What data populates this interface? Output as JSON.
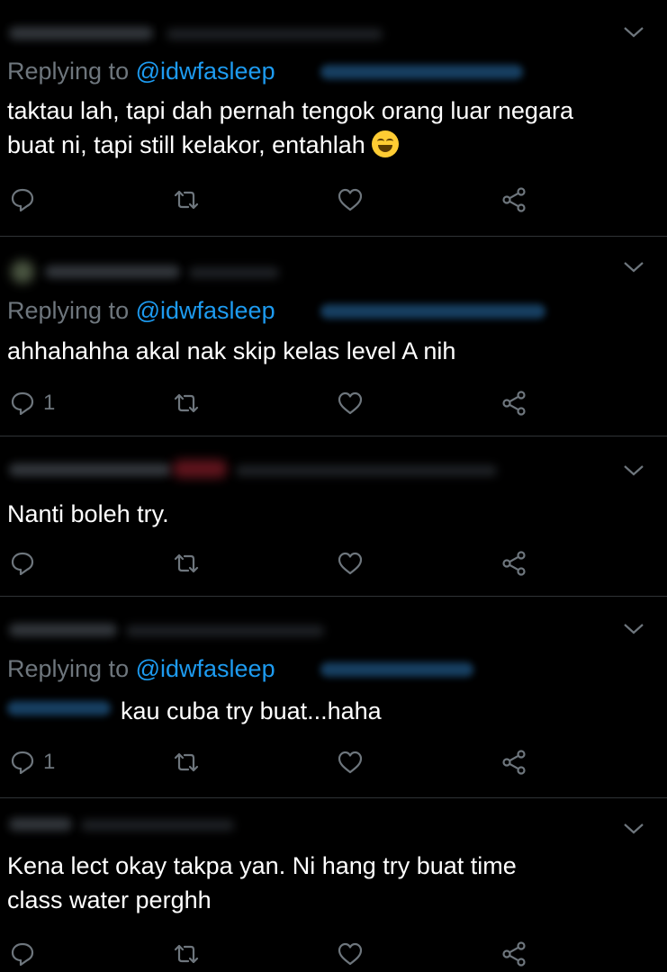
{
  "colors": {
    "background": "#000000",
    "text": "#ffffff",
    "muted": "#6e767d",
    "mention": "#1d9bf0",
    "divider": "#2f3336"
  },
  "tweets": [
    {
      "replying_prefix": "Replying to ",
      "replying_mention": "@idwfasleep",
      "text_line1": "taktau lah, tapi dah pernah tengok orang luar negara",
      "text_line2": "buat ni, tapi still kelakor, entahlah",
      "emoji": "face-with-tears-of-joy",
      "reply_count": ""
    },
    {
      "replying_prefix": "Replying to ",
      "replying_mention": "@idwfasleep",
      "text_line1": "ahhahahha  akal nak skip kelas level A nih",
      "reply_count": "1"
    },
    {
      "text_line1": "Nanti boleh try.",
      "reply_count": ""
    },
    {
      "replying_prefix": "Replying to ",
      "replying_mention": "@idwfasleep",
      "text_line1": "kau cuba try buat...haha",
      "reply_count": "1"
    },
    {
      "text_line1": "Kena lect okay takpa yan. Ni hang try buat time",
      "text_line2": "class water perghh",
      "reply_count": ""
    }
  ],
  "icons": [
    "reply-icon",
    "retweet-icon",
    "like-icon",
    "share-icon",
    "chevron-down-icon"
  ]
}
